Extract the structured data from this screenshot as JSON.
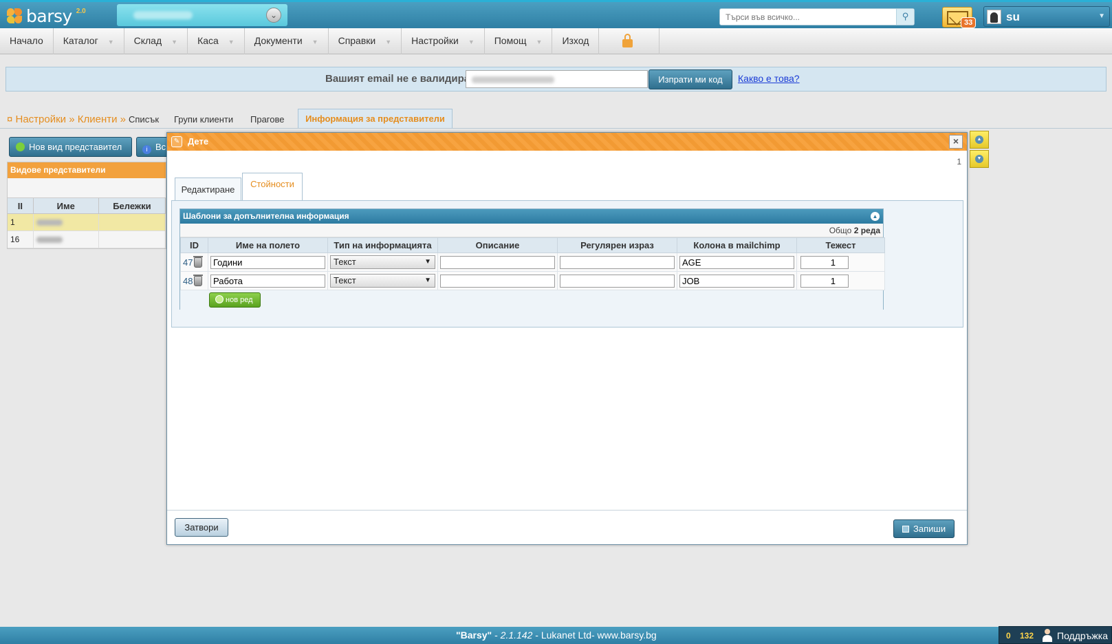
{
  "app": {
    "logo_text": "barsy",
    "logo_version": "2.0"
  },
  "topbar": {
    "search_placeholder": "Търси във всичко...",
    "mail_count": "33",
    "user_name": "su"
  },
  "menu": {
    "items": [
      {
        "label": "Начало",
        "has_caret": false
      },
      {
        "label": "Каталог",
        "has_caret": true
      },
      {
        "label": "Склад",
        "has_caret": true
      },
      {
        "label": "Каса",
        "has_caret": true
      },
      {
        "label": "Документи",
        "has_caret": true
      },
      {
        "label": "Справки",
        "has_caret": true
      },
      {
        "label": "Настройки",
        "has_caret": true
      },
      {
        "label": "Помощ",
        "has_caret": true
      },
      {
        "label": "Изход",
        "has_caret": false
      }
    ]
  },
  "email_warning": {
    "message": "Вашият email не е валидиран!",
    "send_code_label": "Изпрати ми код",
    "what_is_this_label": "Какво е това?"
  },
  "page": {
    "breadcrumb": "¤ Настройки » Клиенти »",
    "tabs": [
      {
        "label": "Списък"
      },
      {
        "label": "Групи клиенти"
      },
      {
        "label": "Прагове"
      }
    ],
    "active_tab": "Информация за представители",
    "new_rep_button": "Нов вид представител",
    "all_button": "Вс",
    "panel_title": "Видове представители",
    "columns": [
      "II",
      "Име",
      "Бележки"
    ],
    "rows": [
      {
        "id": "1"
      },
      {
        "id": "16"
      }
    ]
  },
  "modal": {
    "title": "Дете",
    "counter": "1",
    "tabs": {
      "edit": "Редактиране",
      "values": "Стойности"
    },
    "templates": {
      "title": "Шаблони за допълнителна информация",
      "total_label": "Общо",
      "total_value": "2 реда",
      "columns": [
        "ID",
        "Име на полето",
        "Тип на информацията",
        "Описание",
        "Регулярен израз",
        "Колона в mailchimp",
        "Тежест"
      ],
      "rows": [
        {
          "id": "47",
          "name": "Години",
          "type": "Текст",
          "description": "",
          "regex": "",
          "mailchimp": "AGE",
          "weight": "1"
        },
        {
          "id": "48",
          "name": "Работа",
          "type": "Текст",
          "description": "",
          "regex": "",
          "mailchimp": "JOB",
          "weight": "1"
        }
      ],
      "new_row_label": "нов ред"
    },
    "close_label": "Затвори",
    "save_label": "Запиши"
  },
  "footer": {
    "brand": "\"Barsy\"",
    "sep1": " - ",
    "version": "2.1.142",
    "rest": " - Lukanet Ltd- www.barsy.bg",
    "support_count_1": "0",
    "support_count_2": "132",
    "support_label": "Поддръжка"
  },
  "colors": {
    "accent_blue": "#2f7fa4",
    "accent_orange": "#f29a33",
    "link_orange": "#e58d1e"
  }
}
